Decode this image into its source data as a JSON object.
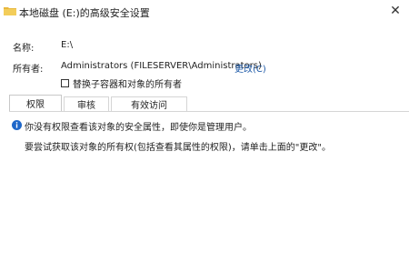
{
  "window": {
    "title": "本地磁盘 (E:)的高级安全设置",
    "folder_icon": "folder-icon",
    "close_glyph": "✕"
  },
  "details": {
    "name_label": "名称:",
    "name_value": "E:\\",
    "owner_label": "所有者:",
    "owner_value": "Administrators (FILESERVER\\Administrators)",
    "change_link": "更改(C)",
    "replace_owner_checkbox": {
      "label": "替换子容器和对象的所有者",
      "checked": false
    }
  },
  "tabs": [
    {
      "label": "权限",
      "active": true
    },
    {
      "label": "审核",
      "active": false
    },
    {
      "label": "有效访问",
      "active": false
    }
  ],
  "panel": {
    "info_icon": "info-icon",
    "message1": "你没有权限查看该对象的安全属性，即使你是管理用户。",
    "message2": "要尝试获取该对象的所有权(包括查看其属性的权限)，请单击上面的\"更改\"。"
  },
  "colors": {
    "link": "#1e5aa8",
    "info_icon": "#1f67c9",
    "folder": "#e8b73c"
  }
}
